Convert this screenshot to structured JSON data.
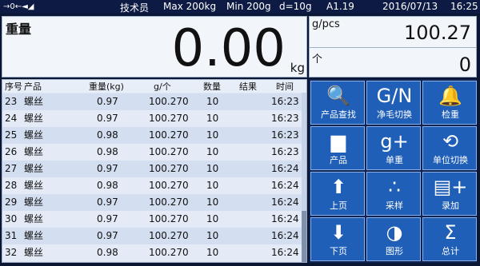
{
  "status_bar": {
    "user": "技术员",
    "max": "Max 200kg",
    "min": "Min 200g",
    "d": "d=10g",
    "version": "A1.19",
    "date": "2016/07/13",
    "time": "16:25",
    "stability_icon": "→0←◄◢"
  },
  "weight": {
    "label": "重量",
    "value": "0.00",
    "unit": "kg"
  },
  "side": {
    "gpcs_label": "g/pcs",
    "gpcs_value": "100.27",
    "count_label": "个",
    "count_value": "0"
  },
  "table": {
    "headers": [
      "序号",
      "产品",
      "重量(kg)",
      "g/个",
      "数量",
      "结果",
      "时间"
    ],
    "rows": [
      [
        "23",
        "螺丝",
        "0.97",
        "100.270",
        "10",
        "",
        "16:23"
      ],
      [
        "24",
        "螺丝",
        "0.97",
        "100.270",
        "10",
        "",
        "16:23"
      ],
      [
        "25",
        "螺丝",
        "0.98",
        "100.270",
        "10",
        "",
        "16:23"
      ],
      [
        "26",
        "螺丝",
        "0.98",
        "100.270",
        "10",
        "",
        "16:23"
      ],
      [
        "27",
        "螺丝",
        "0.97",
        "100.270",
        "10",
        "",
        "16:24"
      ],
      [
        "28",
        "螺丝",
        "0.98",
        "100.270",
        "10",
        "",
        "16:24"
      ],
      [
        "29",
        "螺丝",
        "0.97",
        "100.270",
        "10",
        "",
        "16:24"
      ],
      [
        "30",
        "螺丝",
        "0.97",
        "100.270",
        "10",
        "",
        "16:24"
      ],
      [
        "31",
        "螺丝",
        "0.97",
        "100.270",
        "10",
        "",
        "16:24"
      ],
      [
        "32",
        "螺丝",
        "0.98",
        "100.270",
        "10",
        "",
        "16:24"
      ]
    ]
  },
  "buttons": [
    {
      "icon": "search-icon",
      "glyph": "🔍",
      "label": "产品查找"
    },
    {
      "icon": "gn-icon",
      "glyph": "G/N",
      "label": "净毛切换"
    },
    {
      "icon": "bell-icon",
      "glyph": "🔔",
      "label": "检重"
    },
    {
      "icon": "product-icon",
      "glyph": "▆",
      "label": "产品"
    },
    {
      "icon": "g-plus-icon",
      "glyph": "g+",
      "label": "单重"
    },
    {
      "icon": "unit-switch-icon",
      "glyph": "⟲",
      "label": "单位切换"
    },
    {
      "icon": "arrow-up-icon",
      "glyph": "⬆",
      "label": "上页"
    },
    {
      "icon": "sample-icon",
      "glyph": "∴",
      "label": "采样"
    },
    {
      "icon": "record-add-icon",
      "glyph": "▤+",
      "label": "录加"
    },
    {
      "icon": "arrow-down-icon",
      "glyph": "⬇",
      "label": "下页"
    },
    {
      "icon": "graph-icon",
      "glyph": "◑",
      "label": "图形"
    },
    {
      "icon": "sigma-icon",
      "glyph": "Σ",
      "label": "总计"
    }
  ],
  "colors": {
    "button_bg": "#1f5fb8",
    "background": "#0b1633"
  }
}
